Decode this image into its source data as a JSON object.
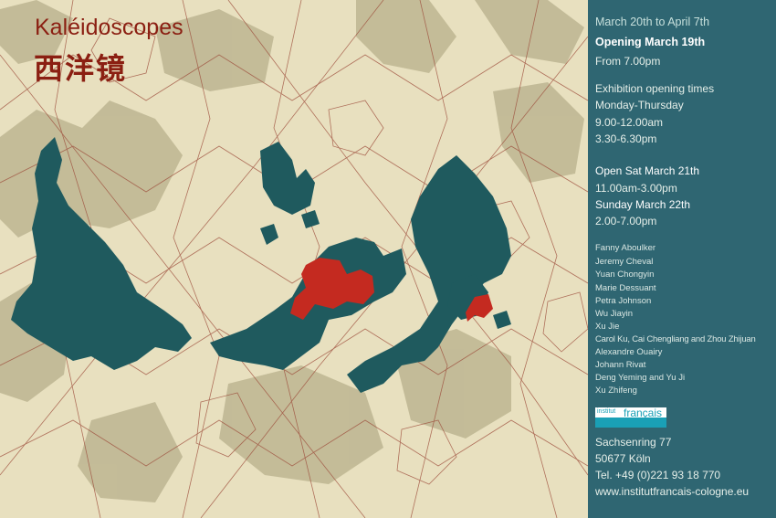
{
  "title": "Kaléidoscopes",
  "title_cn": "西洋镜",
  "schedule": {
    "dates": "March 20th to April 7th",
    "opening": "Opening March 19th",
    "from": "From 7.00pm",
    "times_heading": "Exhibition opening times",
    "weekdays": "Monday-Thursday",
    "morning": "9.00-12.00am",
    "afternoon": "3.30-6.30pm",
    "sat_heading": "Open Sat March 21th",
    "sat_hours": "11.00am-3.00pm",
    "sun_heading": "Sunday March 22th",
    "sun_hours": "2.00-7.00pm"
  },
  "artists": [
    "Fanny Aboulker",
    "Jeremy Cheval",
    "Yuan Chongyin",
    "Marie Dessuant",
    "Petra Johnson",
    "Wu Jiayin",
    "Xu Jie",
    "Carol Ku, Cai Chengliang and Zhou Zhijuan",
    "Alexandre Ouairy",
    "Johann Rivat",
    "Deng Yeming and Yu Ji",
    "Xu Zhifeng"
  ],
  "logo": {
    "top": "institut",
    "bottom": "français"
  },
  "address": {
    "street": "Sachsenring 77",
    "city": "50677 Köln",
    "phone": "Tel. +49 (0)221 93 18 770",
    "web": "www.institutfrancais-cologne.eu"
  },
  "colors": {
    "background": "#e8e0bf",
    "map_shadow": "#a59e79",
    "landmass": "#1f5a5e",
    "highlight": "#c42a20",
    "lines": "#9c4b3a",
    "sidebar": "#2f6672",
    "title": "#8b1f12",
    "logo_accent": "#1aa0b6"
  }
}
